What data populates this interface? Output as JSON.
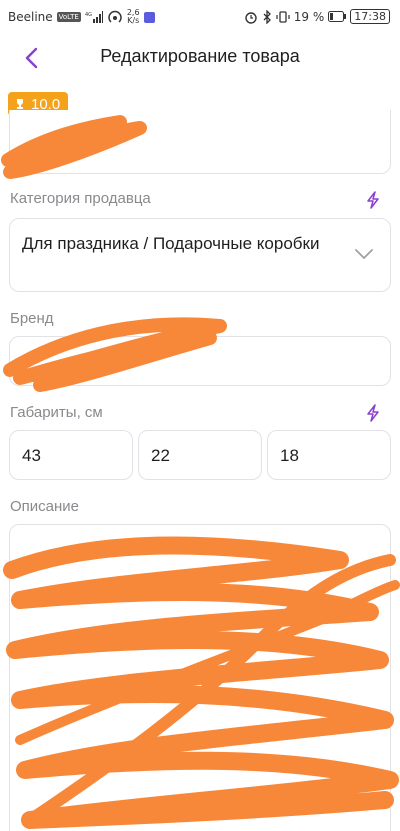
{
  "status_bar": {
    "carrier": "Beeline",
    "volte": "VoLTE",
    "network": "4G",
    "speed_value": "2,6",
    "speed_unit": "K/s",
    "battery": "19 %",
    "time": "17:38"
  },
  "header": {
    "title": "Редактирование товара"
  },
  "score": {
    "value": "10.0"
  },
  "category": {
    "label": "Категория продавца",
    "value": "Для праздника / Подарочные коробки"
  },
  "brand": {
    "label": "Бренд",
    "value": ""
  },
  "dimensions": {
    "label": "Габариты, см",
    "length": "43",
    "width": "22",
    "height": "18"
  },
  "description": {
    "label": "Описание"
  },
  "colors": {
    "accent": "#8a3fd0",
    "badge": "#f4a21c",
    "redaction": "#f7883a"
  }
}
